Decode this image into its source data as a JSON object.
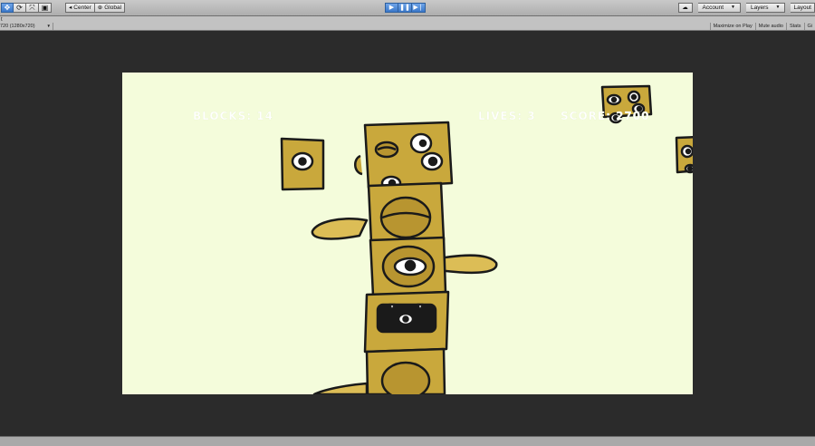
{
  "toolbar": {
    "transform_tools": [
      {
        "name": "move-tool-icon",
        "glyph": "✥"
      },
      {
        "name": "rotate-tool-icon",
        "glyph": "⟳"
      },
      {
        "name": "scale-tool-icon",
        "glyph": "⤧"
      },
      {
        "name": "rect-tool-icon",
        "glyph": "▣"
      }
    ],
    "pivot_label": "Center",
    "space_label": "Global",
    "account_label": "Account",
    "layers_label": "Layers",
    "layout_label": "Layout",
    "accent_color": "#3a78c9"
  },
  "game_view": {
    "tab_label": "t",
    "resolution_label": "720 (1280x720)",
    "options": [
      "Maximize on Play",
      "Mute audio",
      "Stats",
      "Gi"
    ]
  },
  "game": {
    "background_color": "#f4fcdb",
    "hud": {
      "blocks_text": "BLOCKS: 14",
      "lives_text": "LIVES: 3",
      "score_text": "SCORE: 2700"
    }
  }
}
